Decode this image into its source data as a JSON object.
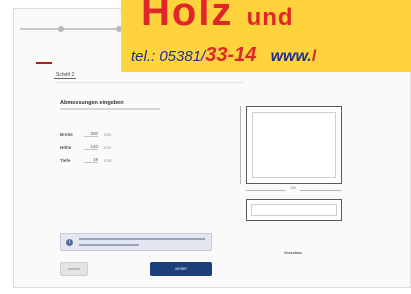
{
  "banner": {
    "headline_main": "Holz",
    "headline_small": "und",
    "phone_prefix": "tel.: 05381/",
    "phone_number": "33-14",
    "web_prefix": "www.",
    "web_rest": "l",
    "background_color": "#ffd33b",
    "accent_color": "#e0262a",
    "text_color": "#1d2f8f"
  },
  "nav": {
    "tabs": [
      {
        "label": "Schritt 2"
      },
      {
        "label": ""
      }
    ]
  },
  "form": {
    "title": "Abmessungen eingeben",
    "rows": [
      {
        "label": "Breite",
        "value": "200",
        "unit": "mm"
      },
      {
        "label": "Höhe",
        "value": "120",
        "unit": "mm"
      },
      {
        "label": "Tiefe",
        "value": "19",
        "unit": "mm"
      }
    ]
  },
  "info": {
    "icon": "info-icon"
  },
  "buttons": {
    "back": "zurück",
    "next": "weiter"
  },
  "preview": {
    "dimension_label": "200",
    "caption": "Vorschau"
  },
  "colors": {
    "primary_button": "#1d3f7a",
    "tab_accent": "#b02020"
  }
}
